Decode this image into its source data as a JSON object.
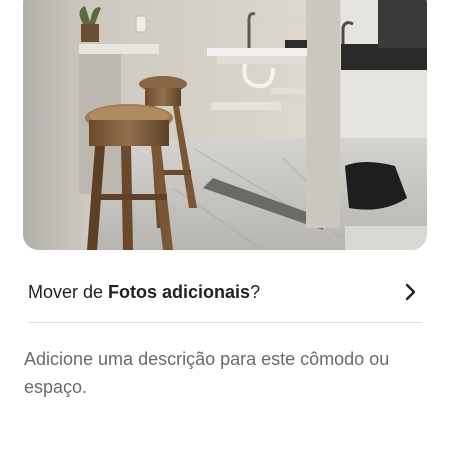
{
  "photo": {
    "alt_icon": "room-photo"
  },
  "move_row": {
    "prefix": "Mover de ",
    "album": "Fotos adicionais",
    "suffix": "?",
    "chevron_icon": "chevron-right-icon"
  },
  "description": {
    "placeholder": "Adicione uma descrição para este cômodo ou espaço."
  },
  "colors": {
    "text_primary": "#222222",
    "text_secondary": "#6a6a6a",
    "divider": "#dddddd"
  }
}
